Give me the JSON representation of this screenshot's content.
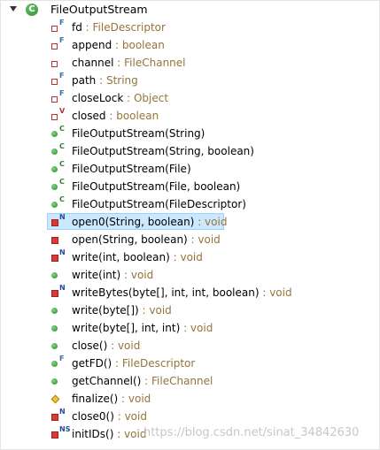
{
  "root": {
    "name": "FileOutputStream",
    "class_icon_letter": "C"
  },
  "members": [
    {
      "icon": "field-private",
      "modifier": "F",
      "name": "fd",
      "type": "FileDescriptor"
    },
    {
      "icon": "field-private",
      "modifier": "F",
      "name": "append",
      "type": "boolean"
    },
    {
      "icon": "field-private",
      "modifier": "",
      "name": "channel",
      "type": "FileChannel"
    },
    {
      "icon": "field-private",
      "modifier": "F",
      "name": "path",
      "type": "String"
    },
    {
      "icon": "field-private",
      "modifier": "F",
      "name": "closeLock",
      "type": "Object"
    },
    {
      "icon": "field-private",
      "modifier": "V",
      "name": "closed",
      "type": "boolean"
    },
    {
      "icon": "method-public",
      "modifier": "C",
      "name": "FileOutputStream(String)",
      "type": ""
    },
    {
      "icon": "method-public",
      "modifier": "C",
      "name": "FileOutputStream(String, boolean)",
      "type": ""
    },
    {
      "icon": "method-public",
      "modifier": "C",
      "name": "FileOutputStream(File)",
      "type": ""
    },
    {
      "icon": "method-public",
      "modifier": "C",
      "name": "FileOutputStream(File, boolean)",
      "type": ""
    },
    {
      "icon": "method-public",
      "modifier": "C",
      "name": "FileOutputStream(FileDescriptor)",
      "type": ""
    },
    {
      "icon": "method-private",
      "modifier": "N",
      "name": "open0(String, boolean)",
      "type": "void",
      "selected": true
    },
    {
      "icon": "method-private",
      "modifier": "",
      "name": "open(String, boolean)",
      "type": "void"
    },
    {
      "icon": "method-private",
      "modifier": "N",
      "name": "write(int, boolean)",
      "type": "void"
    },
    {
      "icon": "method-public",
      "modifier": "",
      "name": "write(int)",
      "type": "void"
    },
    {
      "icon": "method-private",
      "modifier": "N",
      "name": "writeBytes(byte[], int, int, boolean)",
      "type": "void"
    },
    {
      "icon": "method-public",
      "modifier": "",
      "name": "write(byte[])",
      "type": "void"
    },
    {
      "icon": "method-public",
      "modifier": "",
      "name": "write(byte[], int, int)",
      "type": "void"
    },
    {
      "icon": "method-public",
      "modifier": "",
      "name": "close()",
      "type": "void"
    },
    {
      "icon": "method-public",
      "modifier": "F",
      "name": "getFD()",
      "type": "FileDescriptor"
    },
    {
      "icon": "method-public",
      "modifier": "",
      "name": "getChannel()",
      "type": "FileChannel"
    },
    {
      "icon": "method-protected",
      "modifier": "",
      "name": "finalize()",
      "type": "void"
    },
    {
      "icon": "method-private",
      "modifier": "N",
      "name": "close0()",
      "type": "void"
    },
    {
      "icon": "method-private",
      "modifier": "NS",
      "name": "initIDs()",
      "type": "void"
    }
  ],
  "separator": " : ",
  "watermark": "https://blog.csdn.net/sinat_34842630"
}
